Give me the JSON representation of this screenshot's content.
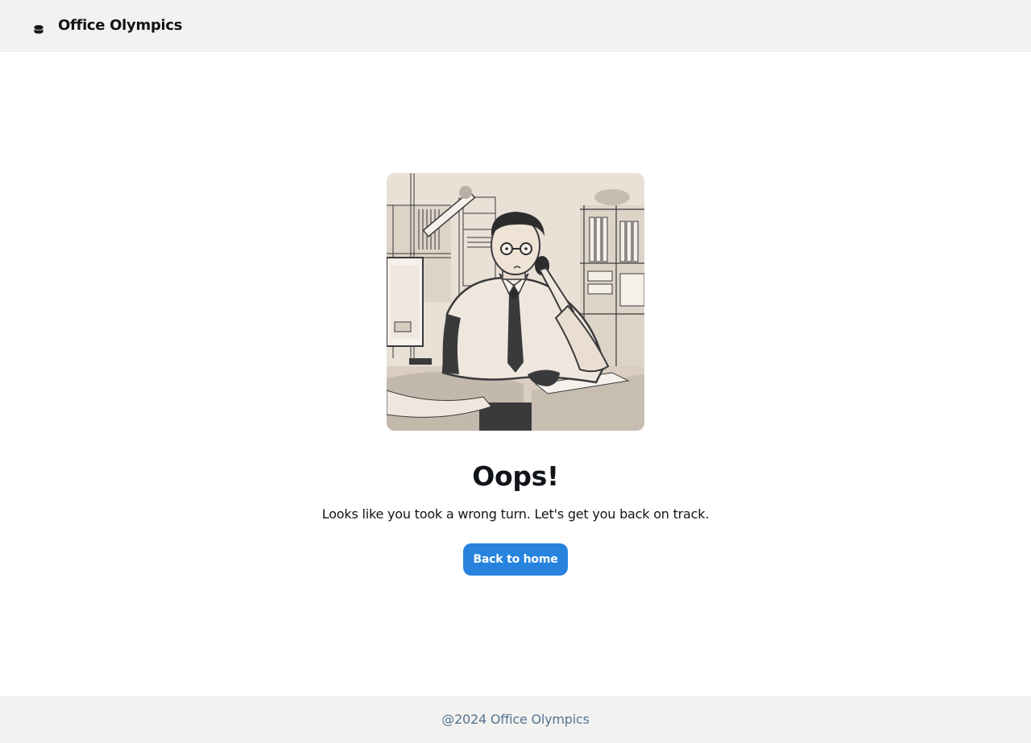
{
  "header": {
    "brand_icon": "database-icon",
    "brand_title": "Office Olympics"
  },
  "main": {
    "illustration_icon": "office-worker-illustration",
    "heading": "Oops!",
    "message": "Looks like you took a wrong turn. Let's get you back on track.",
    "button_label": "Back to home"
  },
  "footer": {
    "text": "@2024 Office Olympics"
  },
  "colors": {
    "header_bg": "#f2f2f0",
    "footer_bg": "#f2f2f0",
    "button_bg": "#2783de",
    "footer_text": "#557591",
    "text_primary": "#111418"
  }
}
